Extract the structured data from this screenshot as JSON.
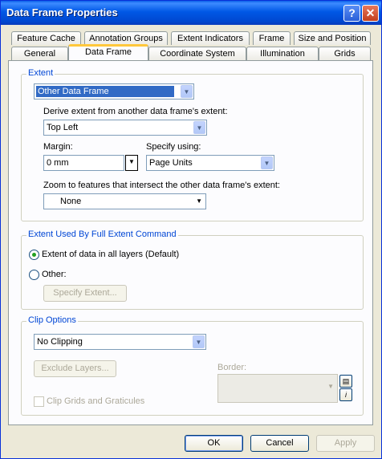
{
  "window": {
    "title": "Data Frame Properties",
    "help": "?",
    "close": "✕"
  },
  "tabs_row1": [
    "Feature Cache",
    "Annotation Groups",
    "Extent Indicators",
    "Frame",
    "Size and Position"
  ],
  "tabs_row2": [
    "General",
    "Data Frame",
    "Coordinate System",
    "Illumination",
    "Grids"
  ],
  "extent": {
    "group_label": "Extent",
    "mode_value": "Other Data Frame",
    "derive_label": "Derive extent from another data frame's extent:",
    "derive_value": "Top Left",
    "margin_label": "Margin:",
    "margin_value": "0 mm",
    "specify_label": "Specify using:",
    "specify_value": "Page Units",
    "zoom_label": "Zoom to features that intersect the other data frame's extent:",
    "zoom_value": "None"
  },
  "full_extent": {
    "group_label": "Extent Used By Full Extent Command",
    "option_default": "Extent of data in all layers (Default)",
    "option_other": "Other:",
    "specify_button": "Specify Extent..."
  },
  "clip": {
    "group_label": "Clip Options",
    "clip_value": "No Clipping",
    "exclude_button": "Exclude Layers...",
    "border_label": "Border:",
    "clip_grids_label": "Clip Grids and Graticules"
  },
  "footer": {
    "ok": "OK",
    "cancel": "Cancel",
    "apply": "Apply"
  }
}
